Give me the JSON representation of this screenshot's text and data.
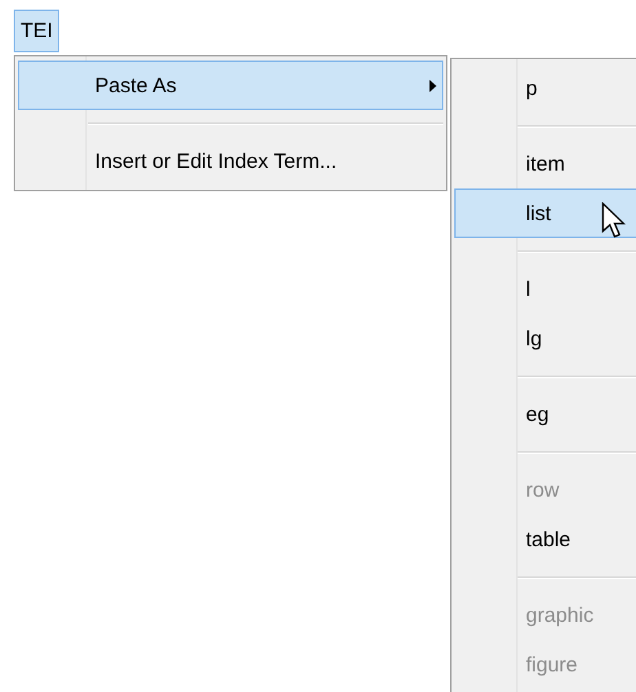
{
  "menubar": [
    {
      "label": "TEI",
      "selected": true
    }
  ],
  "menu": {
    "items": [
      {
        "kind": "item",
        "label": "Paste As",
        "selected": true,
        "submenu": true
      },
      {
        "kind": "separator"
      },
      {
        "kind": "item",
        "label": "Insert or Edit Index Term...",
        "selected": false,
        "submenu": false
      }
    ]
  },
  "submenu": {
    "items": [
      {
        "kind": "item",
        "label": "p",
        "selected": false,
        "disabled": false
      },
      {
        "kind": "separator"
      },
      {
        "kind": "item",
        "label": "item",
        "selected": false,
        "disabled": false
      },
      {
        "kind": "item",
        "label": "list",
        "selected": true,
        "disabled": false
      },
      {
        "kind": "separator"
      },
      {
        "kind": "item",
        "label": "l",
        "selected": false,
        "disabled": false
      },
      {
        "kind": "item",
        "label": "lg",
        "selected": false,
        "disabled": false
      },
      {
        "kind": "separator"
      },
      {
        "kind": "item",
        "label": "eg",
        "selected": false,
        "disabled": false
      },
      {
        "kind": "separator"
      },
      {
        "kind": "item",
        "label": "row",
        "selected": false,
        "disabled": true
      },
      {
        "kind": "item",
        "label": "table",
        "selected": false,
        "disabled": false
      },
      {
        "kind": "separator"
      },
      {
        "kind": "item",
        "label": "graphic",
        "selected": false,
        "disabled": true
      },
      {
        "kind": "item",
        "label": "figure",
        "selected": false,
        "disabled": true
      }
    ]
  }
}
